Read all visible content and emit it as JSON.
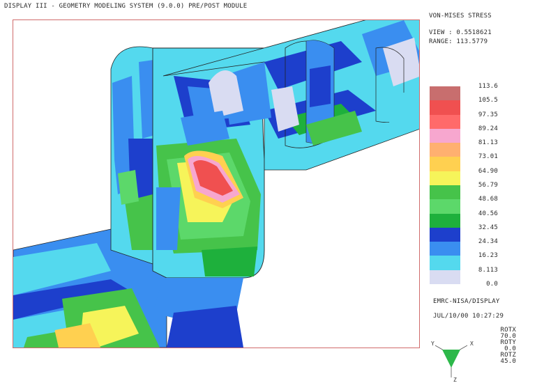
{
  "header": {
    "title": "DISPLAY III - GEOMETRY MODELING SYSTEM (9.0.0)  PRE/POST MODULE"
  },
  "legend": {
    "title": "VON-MISES STRESS",
    "view_text": "VIEW : 0.5518621",
    "range_text": "RANGE: 113.5779",
    "levels": [
      "113.6",
      "105.5",
      "97.35",
      "89.24",
      "81.13",
      "73.01",
      "64.90",
      "56.79",
      "48.68",
      "40.56",
      "32.45",
      "24.34",
      "16.23",
      "8.113",
      "0.0"
    ],
    "colors": [
      "#c86e6e",
      "#f05050",
      "#ff6a6a",
      "#f7a7cf",
      "#ffb070",
      "#ffd050",
      "#f6f45a",
      "#46c34a",
      "#5cd86a",
      "#1eb03c",
      "#1d3fcc",
      "#3a8ef0",
      "#54d9ee",
      "#d9dcf2"
    ]
  },
  "footer": {
    "software": "EMRC-NISA/DISPLAY",
    "datetime": "JUL/10/00 10:27:29",
    "rotx_label": "ROTX",
    "rotx_value": "70.0",
    "roty_label": "ROTY",
    "roty_value": "0.0",
    "rotz_label": "ROTZ",
    "rotz_value": "45.0"
  },
  "triad": {
    "y_label": "Y",
    "x_label": "X",
    "z_label": "Z",
    "color": "#2db84a"
  }
}
